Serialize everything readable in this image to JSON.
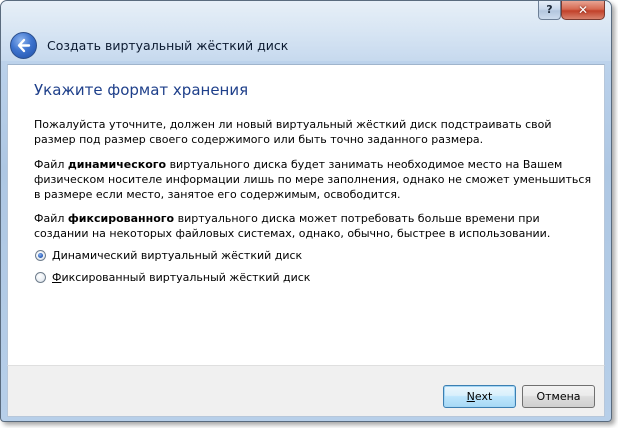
{
  "window": {
    "title": "Создать виртуальный жёсткий диск",
    "help_label": "?",
    "close_label": "✕"
  },
  "content": {
    "heading": "Укажите формат хранения",
    "intro": "Пожалуйста уточните, должен ли новый виртуальный жёсткий диск подстраивать свой размер под размер своего содержимого или быть точно заданного размера.",
    "dynamic_para": {
      "prefix": "Файл ",
      "bold": "динамического",
      "suffix": " виртуального диска будет занимать необходимое место на Вашем физическом носителе информации лишь по мере заполнения, однако не сможет уменьшиться в размере если место, занятое его содержимым, освободится."
    },
    "fixed_para": {
      "prefix": "Файл ",
      "bold": "фиксированного",
      "suffix": " виртуального диска может потребовать больше времени при создании на некоторых файловых системах, однако, обычно, быстрее в использовании."
    },
    "options": [
      {
        "label": "Динамический виртуальный жёсткий диск",
        "mnemonic": "Д",
        "rest": "инамический виртуальный жёсткий диск",
        "checked": true
      },
      {
        "label": "Фиксированный виртуальный жёсткий диск",
        "mnemonic": "Ф",
        "rest": "иксированный виртуальный жёсткий диск",
        "checked": false
      }
    ]
  },
  "footer": {
    "next_label": "Next",
    "next_mnemonic": "N",
    "next_rest": "ext",
    "cancel_label": "Отмена"
  },
  "colors": {
    "heading": "#1e3f8a",
    "frame": "#b9d0ea"
  },
  "icons": {
    "back": "back-arrow-icon"
  }
}
